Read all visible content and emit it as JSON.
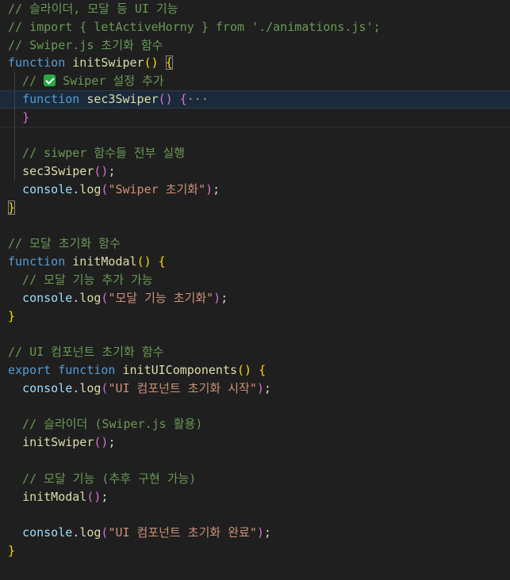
{
  "theme": {
    "background": "#1f1f1f",
    "comment": "#6a9955",
    "keyword": "#569cd6",
    "function": "#dcdcaa",
    "variable": "#9cdcfe",
    "string": "#ce9178",
    "bracket_level_1": "#ffd700",
    "bracket_level_2": "#da70d6",
    "bracket_level_3": "#179fff",
    "plain": "#d4d4d4",
    "current_line": "#1b2a3a"
  },
  "code": {
    "indent_guide_lines": [
      5,
      6,
      7,
      8,
      9,
      10
    ],
    "current_line": 6,
    "lines": [
      [
        {
          "t": "// 슬라이더, 모달 등 UI 기능",
          "c": "comment"
        }
      ],
      [
        {
          "t": "// import { letActiveHorny } from './animations.js';",
          "c": "comment"
        }
      ],
      [
        {
          "t": "// Swiper.js 초기화 함수",
          "c": "comment"
        }
      ],
      [
        {
          "t": "function",
          "c": "keyword"
        },
        {
          "t": " ",
          "c": "plain"
        },
        {
          "t": "initSwiper",
          "c": "fn"
        },
        {
          "t": "()",
          "c": "b1"
        },
        {
          "t": " ",
          "c": "plain"
        },
        {
          "t": "{",
          "c": "b1",
          "match": true
        }
      ],
      [
        {
          "t": "  // ",
          "c": "comment"
        },
        {
          "t": "white-check-mark-icon",
          "c": "icon"
        },
        {
          "t": " Swiper 설정 추가",
          "c": "comment"
        }
      ],
      [
        {
          "t": "  ",
          "c": "plain"
        },
        {
          "t": "function",
          "c": "keyword"
        },
        {
          "t": " ",
          "c": "plain"
        },
        {
          "t": "sec3Swiper",
          "c": "fn"
        },
        {
          "t": "()",
          "c": "b2"
        },
        {
          "t": " ",
          "c": "plain"
        },
        {
          "t": "{",
          "c": "b2"
        },
        {
          "t": "···",
          "c": "fold"
        }
      ],
      [
        {
          "t": "  ",
          "c": "plain"
        },
        {
          "t": "}",
          "c": "b2"
        }
      ],
      [],
      [
        {
          "t": "  // siwper 함수들 전부 실행",
          "c": "comment"
        }
      ],
      [
        {
          "t": "  ",
          "c": "plain"
        },
        {
          "t": "sec3Swiper",
          "c": "fn"
        },
        {
          "t": "()",
          "c": "b2"
        },
        {
          "t": ";",
          "c": "plain"
        }
      ],
      [
        {
          "t": "  ",
          "c": "plain"
        },
        {
          "t": "console",
          "c": "var"
        },
        {
          "t": ".",
          "c": "plain"
        },
        {
          "t": "log",
          "c": "fn"
        },
        {
          "t": "(",
          "c": "b2"
        },
        {
          "t": "\"Swiper 초기화\"",
          "c": "str"
        },
        {
          "t": ")",
          "c": "b2"
        },
        {
          "t": ";",
          "c": "plain"
        }
      ],
      [
        {
          "t": "}",
          "c": "b1",
          "match": true
        }
      ],
      [],
      [
        {
          "t": "// 모달 초기화 함수",
          "c": "comment"
        }
      ],
      [
        {
          "t": "function",
          "c": "keyword"
        },
        {
          "t": " ",
          "c": "plain"
        },
        {
          "t": "initModal",
          "c": "fn"
        },
        {
          "t": "()",
          "c": "b1"
        },
        {
          "t": " ",
          "c": "plain"
        },
        {
          "t": "{",
          "c": "b1"
        }
      ],
      [
        {
          "t": "  // 모달 기능 추가 가능",
          "c": "comment"
        }
      ],
      [
        {
          "t": "  ",
          "c": "plain"
        },
        {
          "t": "console",
          "c": "var"
        },
        {
          "t": ".",
          "c": "plain"
        },
        {
          "t": "log",
          "c": "fn"
        },
        {
          "t": "(",
          "c": "b2"
        },
        {
          "t": "\"모달 기능 초기화\"",
          "c": "str"
        },
        {
          "t": ")",
          "c": "b2"
        },
        {
          "t": ";",
          "c": "plain"
        }
      ],
      [
        {
          "t": "}",
          "c": "b1"
        }
      ],
      [],
      [
        {
          "t": "// UI 컴포넌트 초기화 함수",
          "c": "comment"
        }
      ],
      [
        {
          "t": "export",
          "c": "keyword"
        },
        {
          "t": " ",
          "c": "plain"
        },
        {
          "t": "function",
          "c": "keyword"
        },
        {
          "t": " ",
          "c": "plain"
        },
        {
          "t": "initUIComponents",
          "c": "fn"
        },
        {
          "t": "()",
          "c": "b1"
        },
        {
          "t": " ",
          "c": "plain"
        },
        {
          "t": "{",
          "c": "b1"
        }
      ],
      [
        {
          "t": "  ",
          "c": "plain"
        },
        {
          "t": "console",
          "c": "var"
        },
        {
          "t": ".",
          "c": "plain"
        },
        {
          "t": "log",
          "c": "fn"
        },
        {
          "t": "(",
          "c": "b2"
        },
        {
          "t": "\"UI 컴포넌트 초기화 시작\"",
          "c": "str"
        },
        {
          "t": ")",
          "c": "b2"
        },
        {
          "t": ";",
          "c": "plain"
        }
      ],
      [],
      [
        {
          "t": "  // 슬라이더 (Swiper.js 활용)",
          "c": "comment"
        }
      ],
      [
        {
          "t": "  ",
          "c": "plain"
        },
        {
          "t": "initSwiper",
          "c": "fn"
        },
        {
          "t": "()",
          "c": "b2"
        },
        {
          "t": ";",
          "c": "plain"
        }
      ],
      [],
      [
        {
          "t": "  // 모달 기능 (추후 구현 가능)",
          "c": "comment"
        }
      ],
      [
        {
          "t": "  ",
          "c": "plain"
        },
        {
          "t": "initModal",
          "c": "fn"
        },
        {
          "t": "()",
          "c": "b2"
        },
        {
          "t": ";",
          "c": "plain"
        }
      ],
      [],
      [
        {
          "t": "  ",
          "c": "plain"
        },
        {
          "t": "console",
          "c": "var"
        },
        {
          "t": ".",
          "c": "plain"
        },
        {
          "t": "log",
          "c": "fn"
        },
        {
          "t": "(",
          "c": "b2"
        },
        {
          "t": "\"UI 컴포넌트 초기화 완료\"",
          "c": "str"
        },
        {
          "t": ")",
          "c": "b2"
        },
        {
          "t": ";",
          "c": "plain"
        }
      ],
      [
        {
          "t": "}",
          "c": "b1"
        }
      ]
    ]
  }
}
